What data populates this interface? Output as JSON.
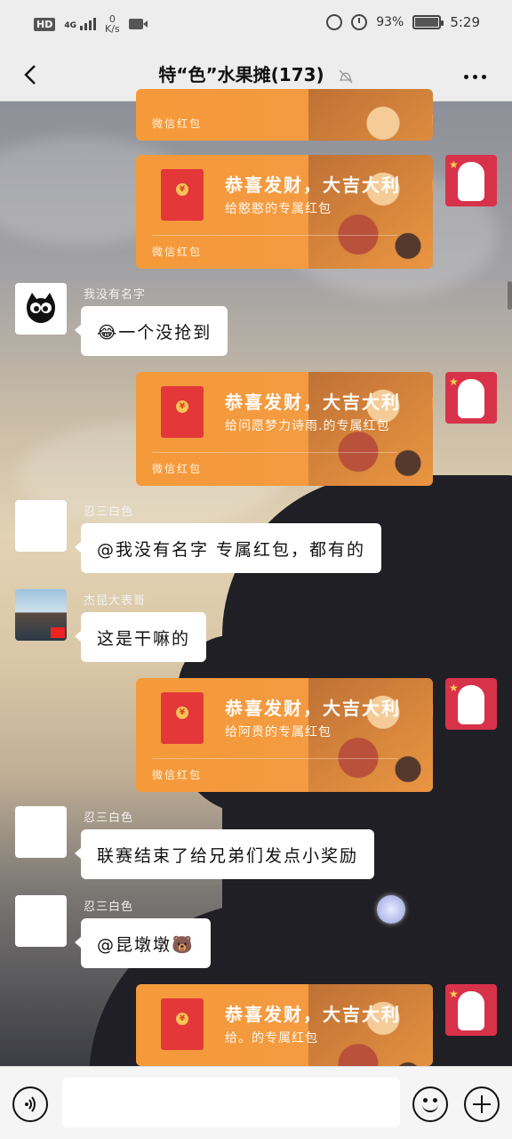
{
  "status_bar": {
    "hd": "HD",
    "network": "4G",
    "speed_value": "0",
    "speed_unit": "K/s",
    "battery_percent": "93%",
    "battery_level": 0.93,
    "time": "5:29"
  },
  "header": {
    "title": "特“色”水果摊(173)"
  },
  "messages": [
    {
      "type": "envelope",
      "from_self": true,
      "title": "",
      "subtitle": "",
      "label": "微信红包"
    },
    {
      "type": "envelope",
      "from_self": true,
      "title": "恭喜发财，大吉大利",
      "subtitle": "给憨憨的专属红包",
      "label": "微信红包"
    },
    {
      "type": "text",
      "sender": "我没有名字",
      "text": "😂一个没抢到"
    },
    {
      "type": "envelope",
      "from_self": true,
      "title": "恭喜发财，大吉大利",
      "subtitle": "给问愿梦力诗雨.的专属红包",
      "label": "微信红包"
    },
    {
      "type": "text",
      "sender": "忍三白色",
      "text": "@我没有名字  专属红包，都有的"
    },
    {
      "type": "text",
      "sender": "杰昆大表哥",
      "text": "这是干嘛的"
    },
    {
      "type": "envelope",
      "from_self": true,
      "title": "恭喜发财，大吉大利",
      "subtitle": "给阿贵的专属红包",
      "label": "微信红包"
    },
    {
      "type": "text",
      "sender": "忍三白色",
      "text": "联赛结束了给兄弟们发点小奖励"
    },
    {
      "type": "text",
      "sender": "忍三白色",
      "text": "@昆墩墩🐻"
    },
    {
      "type": "envelope",
      "from_self": true,
      "title": "恭喜发财，大吉大利",
      "subtitle": "给。的专属红包",
      "label": ""
    }
  ],
  "input": {
    "value": "",
    "placeholder": ""
  }
}
